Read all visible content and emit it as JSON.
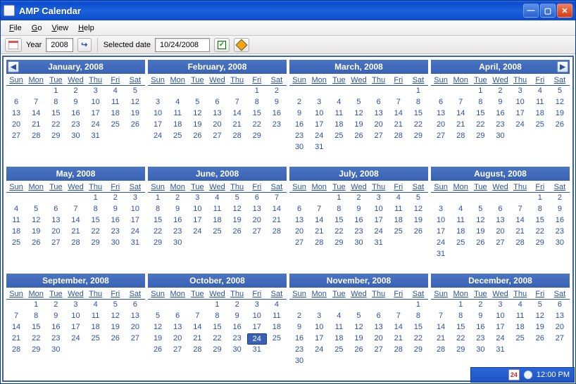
{
  "window": {
    "title": "AMP Calendar"
  },
  "menu": {
    "file": "File",
    "go": "Go",
    "view": "View",
    "help": "Help"
  },
  "toolbar": {
    "year_label": "Year",
    "year_value": "2008",
    "selected_label": "Selected date",
    "selected_value": "10/24/2008"
  },
  "dow": [
    "Sun",
    "Mon",
    "Tue",
    "Wed",
    "Thu",
    "Fri",
    "Sat"
  ],
  "selected": {
    "month": 10,
    "day": 24
  },
  "months": [
    {
      "title": "January, 2008",
      "start": 2,
      "count": 31
    },
    {
      "title": "February, 2008",
      "start": 5,
      "count": 29
    },
    {
      "title": "March, 2008",
      "start": 6,
      "count": 31
    },
    {
      "title": "April, 2008",
      "start": 2,
      "count": 30
    },
    {
      "title": "May, 2008",
      "start": 4,
      "count": 31
    },
    {
      "title": "June, 2008",
      "start": 0,
      "count": 30
    },
    {
      "title": "July, 2008",
      "start": 2,
      "count": 31
    },
    {
      "title": "August, 2008",
      "start": 5,
      "count": 31
    },
    {
      "title": "September, 2008",
      "start": 1,
      "count": 30
    },
    {
      "title": "October, 2008",
      "start": 3,
      "count": 31
    },
    {
      "title": "November, 2008",
      "start": 6,
      "count": 30
    },
    {
      "title": "December, 2008",
      "start": 1,
      "count": 31
    }
  ],
  "tray": {
    "date_badge": "24",
    "time": "12:00 PM"
  }
}
